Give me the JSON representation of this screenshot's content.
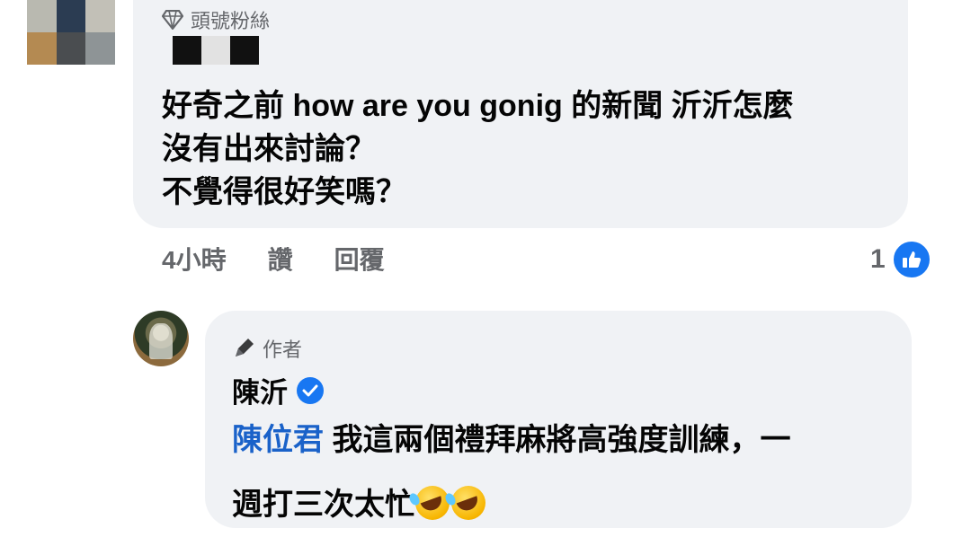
{
  "comment1": {
    "badge_label": "頭號粉絲",
    "text_lines": [
      "好奇之前 how are you gonig 的新聞 沂沂怎麼",
      "沒有出來討論？",
      "不覺得很好笑嗎？"
    ],
    "time": "4小時",
    "like_action": "讚",
    "reply_action": "回覆",
    "like_count": "1"
  },
  "reply": {
    "badge_label": "作者",
    "author_name": "陳沂",
    "mention": "陳位君",
    "text_line1": " 我這兩個禮拜麻將高強度訓練，一",
    "text_line2": "週打三次太忙"
  },
  "colors": {
    "bubble_bg": "#f0f2f5",
    "meta_text": "#65676b",
    "link_blue": "#1a62c9",
    "fb_blue": "#1877f2"
  },
  "icons": {
    "fan_badge": "diamond-icon",
    "author_badge": "pen-icon",
    "verified": "verified-badge-icon",
    "like": "thumbs-up-icon",
    "emoji": "rofl-emoji-icon"
  }
}
